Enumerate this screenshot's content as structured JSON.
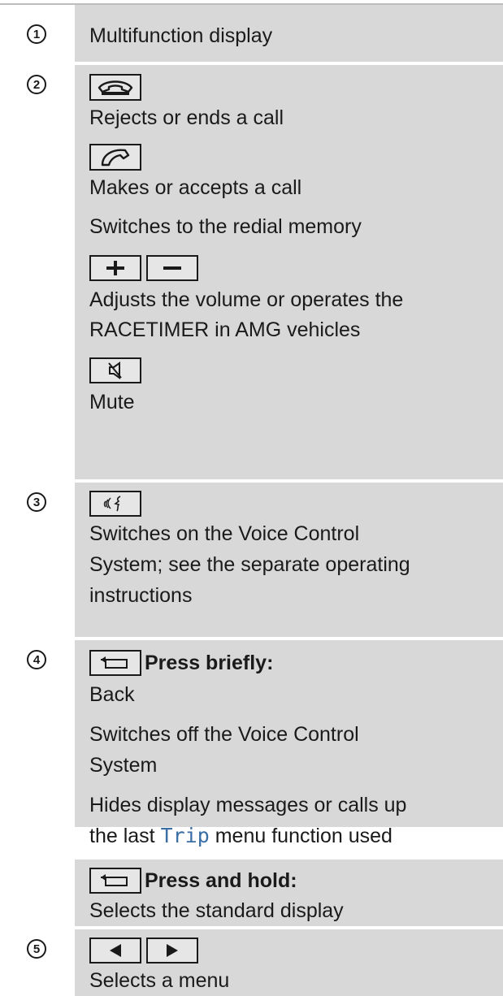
{
  "rows": [
    {
      "num": "1",
      "lines": [
        "Multifunction display"
      ]
    },
    {
      "num": "2",
      "lines": [
        "Rejects or ends a call",
        "Makes or accepts a call",
        "Switches to the redial memory",
        "Adjusts the volume or operates the",
        "RACETIMER in AMG vehicles",
        "Mute"
      ]
    },
    {
      "num": "3",
      "lines": [
        "Switches on the Voice Control",
        "System; see the separate operating",
        "instructions"
      ]
    },
    {
      "num": "4",
      "heading": "Press briefly:",
      "lines": [
        "Back",
        "Switches off the Voice Control",
        "System",
        "Hides display messages or calls up",
        "the last",
        "Trip",
        "menu function used"
      ]
    },
    {
      "num": "",
      "heading": "Press and hold:",
      "lines": [
        "Selects the standard display"
      ]
    },
    {
      "num": "5",
      "lines": [
        "Selects a menu"
      ]
    }
  ],
  "icons": {
    "hangup": "phone-hangup-icon",
    "accept": "phone-accept-icon",
    "plus": "plus-icon",
    "minus": "minus-icon",
    "mute": "mute-icon",
    "voice": "voice-control-icon",
    "back": "back-icon",
    "left": "left-arrow-icon",
    "right": "right-arrow-icon"
  }
}
